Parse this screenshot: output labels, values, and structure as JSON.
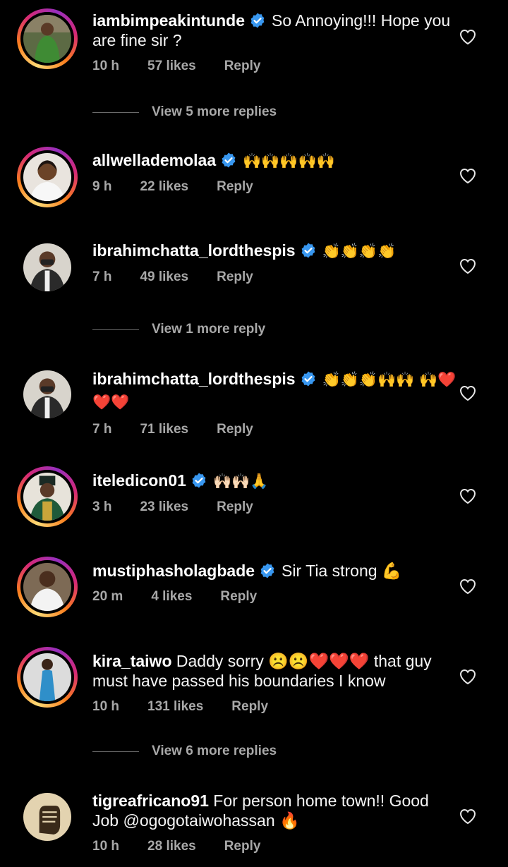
{
  "ui": {
    "reply_label": "Reply"
  },
  "comments": [
    {
      "username": "iambimpeakintunde",
      "verified": true,
      "text": "So Annoying!!! Hope you are fine sir ?",
      "time": "10 h",
      "likes": "57 likes",
      "story_ring": true,
      "avatar": "green-robe-avatar"
    },
    {
      "username": "allwellademolaa",
      "verified": true,
      "text": "🙌🙌🙌🙌🙌",
      "time": "9 h",
      "likes": "22 likes",
      "story_ring": true,
      "avatar": "woman-avatar"
    },
    {
      "username": "ibrahimchatta_lordthespis",
      "verified": true,
      "text": "👏👏👏👏",
      "time": "7 h",
      "likes": "49 likes",
      "story_ring": false,
      "avatar": "man-mask-avatar"
    },
    {
      "username": "ibrahimchatta_lordthespis",
      "verified": true,
      "text": "👏👏👏🙌🙌 🙌❤️❤️❤️",
      "time": "7 h",
      "likes": "71 likes",
      "story_ring": false,
      "avatar": "man-mask-avatar"
    },
    {
      "username": "iteledicon01",
      "verified": true,
      "text": "🙌🏻🙌🏻🙏",
      "time": "3 h",
      "likes": "23 likes",
      "story_ring": true,
      "avatar": "uniform-avatar"
    },
    {
      "username": "mustiphasholagbade",
      "verified": true,
      "text": "Sir Tia strong 💪",
      "time": "20 m",
      "likes": "4 likes",
      "story_ring": true,
      "avatar": "man-white-avatar"
    },
    {
      "username": "kira_taiwo",
      "verified": false,
      "text": "Daddy sorry ☹️☹️❤️❤️❤️ that guy must have passed his boundaries I know",
      "time": "10 h",
      "likes": "131 likes",
      "story_ring": true,
      "avatar": "blue-dress-avatar"
    },
    {
      "username": "tigreafricano91",
      "verified": false,
      "text": "For person home town!! Good Job @ogogotaiwohassan 🔥",
      "time": "10 h",
      "likes": "28 likes",
      "story_ring": false,
      "avatar": "fist-avatar"
    }
  ],
  "view_more": [
    {
      "label": "View 5 more replies"
    },
    {
      "label": "View 1 more reply"
    },
    {
      "label": "View 6 more replies"
    }
  ]
}
